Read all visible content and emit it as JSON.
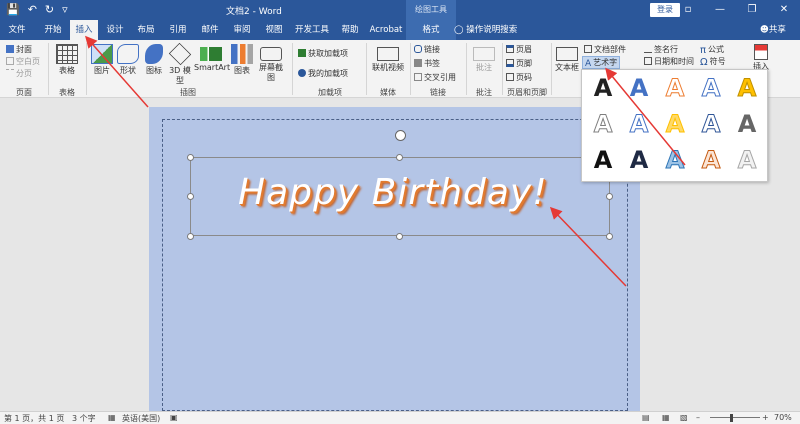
{
  "titlebar": {
    "doc_title": "文档2 - Word",
    "context_tab": "绘图工具",
    "login": "登录"
  },
  "tabs": [
    {
      "label": "文件"
    },
    {
      "label": "开始"
    },
    {
      "label": "插入"
    },
    {
      "label": "设计"
    },
    {
      "label": "布局"
    },
    {
      "label": "引用"
    },
    {
      "label": "邮件"
    },
    {
      "label": "审阅"
    },
    {
      "label": "视图"
    },
    {
      "label": "开发工具"
    },
    {
      "label": "帮助"
    },
    {
      "label": "Acrobat"
    },
    {
      "label": "格式"
    }
  ],
  "tellme": "操作说明搜索",
  "share": "共享",
  "ribbon": {
    "pages": {
      "cover": "封面",
      "blank": "空白页",
      "break": "分页",
      "label": "页面"
    },
    "table": {
      "btn": "表格",
      "label": "表格"
    },
    "illus": {
      "pic": "图片",
      "shape": "形状",
      "icon": "图标",
      "model": "3D 模型",
      "smartart": "SmartArt",
      "chart": "图表",
      "screenshot": "屏幕截图",
      "label": "插图"
    },
    "addins": {
      "get": "获取加载项",
      "mine": "我的加载项",
      "label": "加载项"
    },
    "media": {
      "video": "联机视频",
      "label": "媒体"
    },
    "links": {
      "link": "链接",
      "bookmark": "书签",
      "xref": "交叉引用",
      "label": "链接"
    },
    "comments": {
      "comment": "批注",
      "label": "批注"
    },
    "hf": {
      "header": "页眉",
      "footer": "页脚",
      "pagenum": "页码",
      "label": "页眉和页脚"
    },
    "text": {
      "textbox": "文本框",
      "docparts": "文档部件",
      "wordart": "艺术字",
      "sigline": "签名行",
      "datetime": "日期和时间"
    },
    "symbols": {
      "equation": "公式",
      "symbol": "符号"
    },
    "insert": "插入"
  },
  "gallery": {
    "glyph": "A",
    "styles": [
      {
        "color": "#222222",
        "outline": "none"
      },
      {
        "color": "#4472c4",
        "outline": "none"
      },
      {
        "color": "#ffffff",
        "outline": "#ed7d31"
      },
      {
        "color": "#ffffff",
        "outline": "#4472c4"
      },
      {
        "color": "#ffc000",
        "outline": "#bf9000"
      },
      {
        "color": "#ffffff",
        "outline": "#7f7f7f"
      },
      {
        "color": "#ffffff",
        "outline": "#4472c4"
      },
      {
        "color": "#ffd966",
        "outline": "#ffc000"
      },
      {
        "color": "#ffffff",
        "outline": "#2f5597"
      },
      {
        "color": "#666666",
        "outline": "none"
      },
      {
        "color": "#111111",
        "outline": "none"
      },
      {
        "color": "#1f2a44",
        "outline": "none"
      },
      {
        "color": "#9dc3e6",
        "outline": "#2e75b6"
      },
      {
        "color": "#fbe5d6",
        "outline": "#c55a11"
      },
      {
        "color": "#f2f2f2",
        "outline": "#a6a6a6"
      }
    ]
  },
  "document": {
    "wordart_text": "Happy Birthday!"
  },
  "status": {
    "page": "第 1 页，共 1 页",
    "words": "3 个字",
    "lang": "英语(美国)",
    "zoom": "70%"
  },
  "colors": {
    "brand": "#2b579a",
    "page": "#b4c5e6",
    "arrow": "#e53935"
  }
}
